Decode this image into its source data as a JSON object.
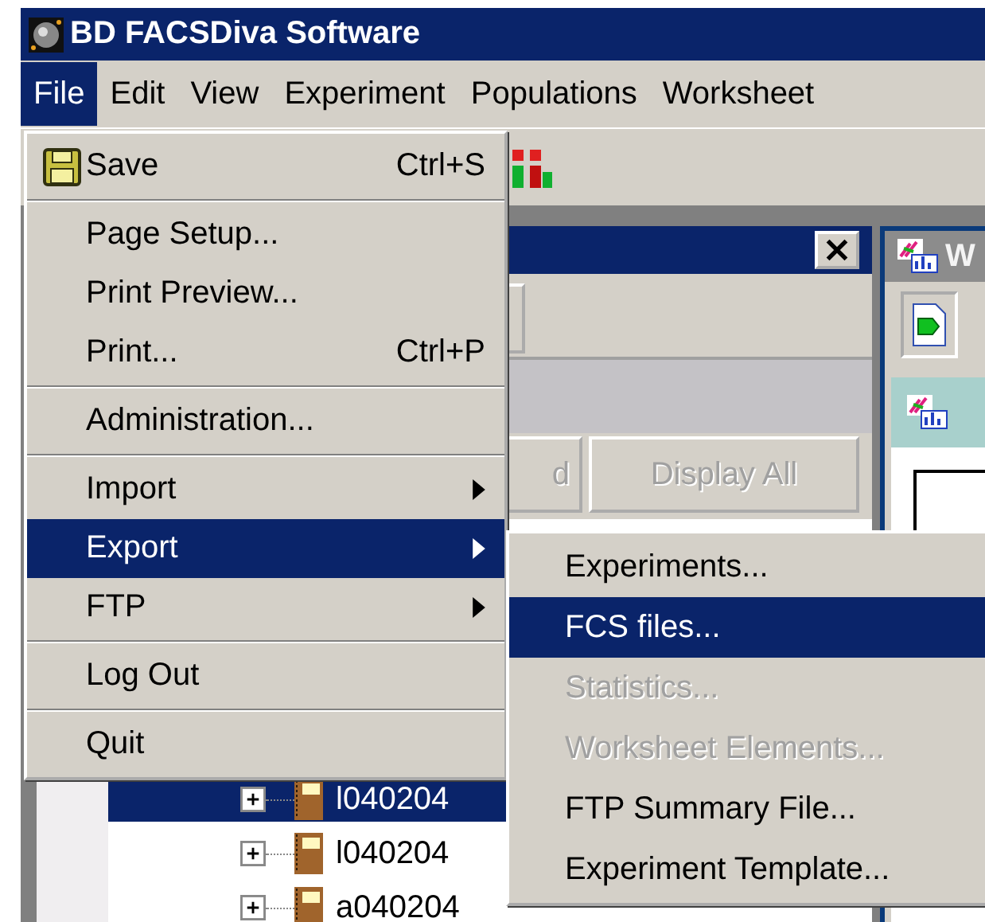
{
  "window": {
    "title": "BD FACSDiva Software"
  },
  "menubar": [
    {
      "label": "File",
      "selected": true
    },
    {
      "label": "Edit",
      "selected": false
    },
    {
      "label": "View",
      "selected": false
    },
    {
      "label": "Experiment",
      "selected": false
    },
    {
      "label": "Populations",
      "selected": false
    },
    {
      "label": "Worksheet",
      "selected": false
    }
  ],
  "browser_panel": {
    "buttons": [
      {
        "label": "d",
        "disabled": true
      },
      {
        "label": "Display All",
        "disabled": true
      }
    ],
    "tree": [
      {
        "label": "l040204",
        "selected": true
      },
      {
        "label": "l040204",
        "selected": false
      },
      {
        "label": "a040204",
        "selected": false
      }
    ]
  },
  "worksheet_panel": {
    "title": "W"
  },
  "file_menu": [
    {
      "kind": "item",
      "label": "Save",
      "shortcut": "Ctrl+S",
      "selected": false
    },
    {
      "kind": "separator"
    },
    {
      "kind": "item",
      "label": "Page Setup...",
      "selected": false
    },
    {
      "kind": "item",
      "label": "Print Preview...",
      "selected": false
    },
    {
      "kind": "item",
      "label": "Print...",
      "shortcut": "Ctrl+P",
      "selected": false
    },
    {
      "kind": "separator"
    },
    {
      "kind": "item",
      "label": "Administration...",
      "selected": false
    },
    {
      "kind": "separator"
    },
    {
      "kind": "submenu",
      "label": "Import",
      "selected": false
    },
    {
      "kind": "submenu",
      "label": "Export",
      "selected": true
    },
    {
      "kind": "submenu",
      "label": "FTP",
      "selected": false
    },
    {
      "kind": "separator"
    },
    {
      "kind": "item",
      "label": "Log Out",
      "selected": false
    },
    {
      "kind": "separator"
    },
    {
      "kind": "item",
      "label": "Quit",
      "selected": false
    }
  ],
  "export_submenu": [
    {
      "label": "Experiments...",
      "selected": false,
      "disabled": false
    },
    {
      "label": "FCS files...",
      "selected": true,
      "disabled": false
    },
    {
      "label": "Statistics...",
      "selected": false,
      "disabled": true
    },
    {
      "label": "Worksheet Elements...",
      "selected": false,
      "disabled": true
    },
    {
      "label": "FTP Summary File...",
      "selected": false,
      "disabled": false
    },
    {
      "label": "Experiment Template...",
      "selected": false,
      "disabled": false
    }
  ]
}
